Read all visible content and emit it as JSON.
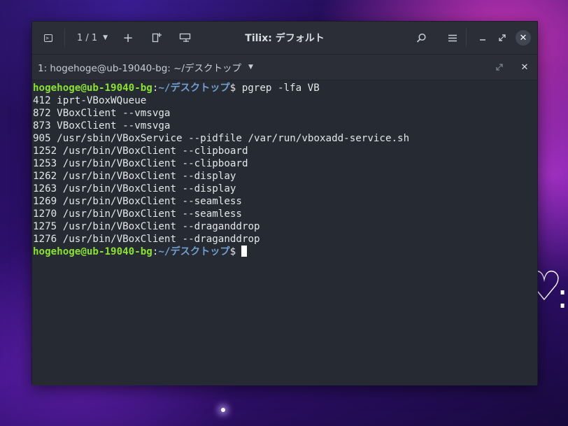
{
  "window": {
    "title": "Tilix: デフォルト",
    "session_switcher": "1 / 1"
  },
  "terminal_header": {
    "title": "1: hogehoge@ub-19040-bg: ~/デスクトップ"
  },
  "prompt": {
    "user_host": "hogehoge@ub-19040-bg",
    "colon": ":",
    "path": "~/デスクトップ",
    "symbol": "$"
  },
  "command": "pgrep -lfa VB",
  "output": [
    "412 iprt-VBoxWQueue",
    "872 VBoxClient --vmsvga",
    "873 VBoxClient --vmsvga",
    "905 /usr/sbin/VBoxService --pidfile /var/run/vboxadd-service.sh",
    "1252 /usr/bin/VBoxClient --clipboard",
    "1253 /usr/bin/VBoxClient --clipboard",
    "1262 /usr/bin/VBoxClient --display",
    "1263 /usr/bin/VBoxClient --display",
    "1269 /usr/bin/VBoxClient --seamless",
    "1270 /usr/bin/VBoxClient --seamless",
    "1275 /usr/bin/VBoxClient --draganddrop",
    "1276 /usr/bin/VBoxClient --draganddrop"
  ],
  "colors": {
    "prompt_user": "#8ae234",
    "prompt_path": "#729fcf",
    "terminal_bg": "#262a33",
    "text": "#e4e6ea"
  },
  "icons": {
    "terminal_menu": "terminal-icon",
    "add": "plus-icon",
    "side_panel": "add-side-icon",
    "sync": "sync-input-icon",
    "find": "search-icon",
    "menu": "hamburger-icon",
    "minimize": "minimize-icon",
    "maximize": "maximize-icon",
    "close": "close-icon"
  }
}
